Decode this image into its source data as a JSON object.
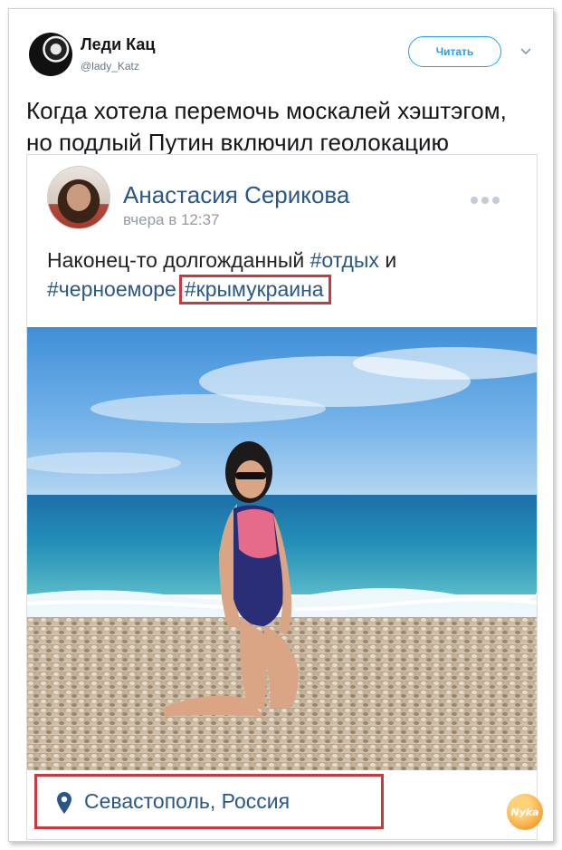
{
  "tweet": {
    "author_name": "Леди Кац",
    "author_handle": "@lady_Katz",
    "follow_label": "Читать",
    "text_line1": "Когда хотела перемочь москалей хэштэгом,",
    "text_line2": "но подлый Путин включил геолокацию"
  },
  "post": {
    "author_name": "Анастасия Серикова",
    "time": "вчера в 12:37",
    "text_prefix": "Наконец-то долгожданный ",
    "tag1": "#отдых",
    "text_mid": " и",
    "tag2": "#черноеморе",
    "tag3": "#крымукраина",
    "location": "Севастополь, Россия"
  },
  "watermark_text": "Nyka",
  "colors": {
    "twitter_blue": "#1da1f2",
    "vk_link": "#2a5885",
    "highlight_red": "#c83a41"
  },
  "icons": {
    "caret": "chevron-down-icon",
    "more": "more-dots-icon",
    "location": "map-pin-icon"
  }
}
